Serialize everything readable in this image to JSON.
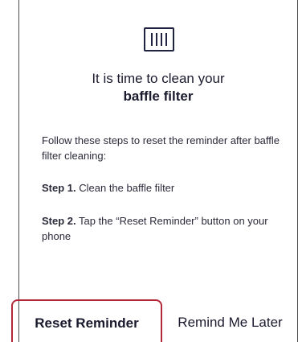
{
  "icon": "baffle-filter-icon",
  "title": {
    "line1": "It is time to clean your",
    "line2": "baffle filter"
  },
  "instructions": {
    "intro": "Follow these steps to reset the reminder after baffle filter cleaning:",
    "step1_label": "Step 1.",
    "step1_text": " Clean the baffle filter",
    "step2_label": "Step 2.",
    "step2_text": " Tap the “Reset Reminder”  button on your phone"
  },
  "buttons": {
    "reset": "Reset Reminder",
    "later": "Remind Me Later"
  },
  "colors": {
    "highlight_border": "#b5283a",
    "text": "#1a1a2e"
  }
}
